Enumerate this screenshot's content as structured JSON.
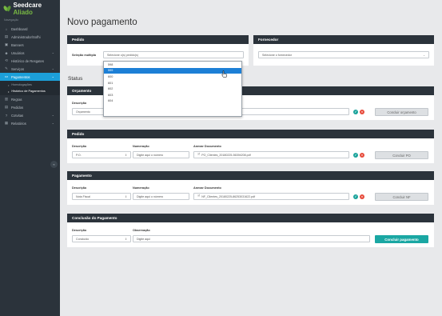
{
  "brand": {
    "name_main": "Seedcare",
    "name_accent": "Aliado"
  },
  "sidebar": {
    "heading": "Navegação",
    "items": [
      {
        "label": "Dashboard",
        "icon": "home-icon",
        "glyph": "⌂",
        "chev": ""
      },
      {
        "label": "Administrador/Sofhi",
        "icon": "building-icon",
        "glyph": "▤",
        "chev": ""
      },
      {
        "label": "Banners",
        "icon": "image-icon",
        "glyph": "▣",
        "chev": ""
      },
      {
        "label": "Usuários",
        "icon": "users-icon",
        "glyph": "☻",
        "chev": "⌄"
      },
      {
        "label": "Histórico de Resgates",
        "icon": "history-icon",
        "glyph": "⟲",
        "chev": ""
      },
      {
        "label": "Serviços",
        "icon": "wrench-icon",
        "glyph": "✎",
        "chev": "⌄"
      },
      {
        "label": "Pagamentos",
        "icon": "money-icon",
        "glyph": "▭",
        "chev": "⌄"
      }
    ],
    "sub_items": [
      {
        "label": "Homologações"
      },
      {
        "label": "Histórico de Pagamentos"
      }
    ],
    "items_after": [
      {
        "label": "Regras",
        "icon": "rules-icon",
        "glyph": "▥",
        "chev": ""
      },
      {
        "label": "Pedidos",
        "icon": "orders-icon",
        "glyph": "▤",
        "chev": ""
      },
      {
        "label": "Cotvitas",
        "icon": "question-icon",
        "glyph": "?",
        "chev": "⌄"
      },
      {
        "label": "Relatórios",
        "icon": "report-icon",
        "glyph": "▦",
        "chev": "⌄"
      }
    ],
    "collapse_glyph": "«"
  },
  "page": {
    "title": "Novo pagamento",
    "status_label": "Status"
  },
  "pedido_top": {
    "header": "Pedido",
    "label": "Seleção múltipla",
    "placeholder": "Selecione o(s) pedido(s)",
    "options": [
      "598",
      "599",
      "600",
      "601",
      "602",
      "603",
      "604"
    ],
    "highlighted": "599"
  },
  "fornecedor": {
    "header": "Fornecedor",
    "placeholder": "Selecione o fornecedor"
  },
  "orcamento": {
    "header": "Orçamento",
    "desc_label": "Descrição",
    "desc_value": "Orçamento",
    "file_value": "...220-52641257.pdf",
    "button": "Concluir orçamento"
  },
  "pedido": {
    "header": "Pedido",
    "desc_label": "Descrição",
    "desc_value": "P.O.",
    "num_label": "Numeração",
    "num_placeholder": "Digite aqui o número",
    "file_label": "Anexar Documento",
    "file_value": "PO_Clientes_20180225-56394208.pdf",
    "button": "Concluir PO"
  },
  "pagamento": {
    "header": "Pagamento",
    "desc_label": "Descrição",
    "desc_value": "Nota Fiscal",
    "num_label": "Numeração",
    "num_placeholder": "Digite aqui o número",
    "file_label": "Anexar Documento",
    "file_value": "NF_Clientes_20180225-86253031622.pdf",
    "button": "Concluir NF"
  },
  "conclusao": {
    "header": "Conclusão do Pagamento",
    "desc_label": "Descrição",
    "desc_value": "Concluído",
    "obs_label": "Observação",
    "obs_placeholder": "Digite aqui",
    "button": "Concluir pagamento"
  },
  "icons": {
    "file": "🗎",
    "confirm": "✓",
    "remove": "×",
    "select_arrow": "⇕"
  },
  "colors": {
    "sidebar_bg": "#2b333b",
    "active_blue": "#1c9fd9",
    "teal": "#1aa7a3",
    "red": "#e74c3c",
    "brand_green": "#78b843"
  }
}
